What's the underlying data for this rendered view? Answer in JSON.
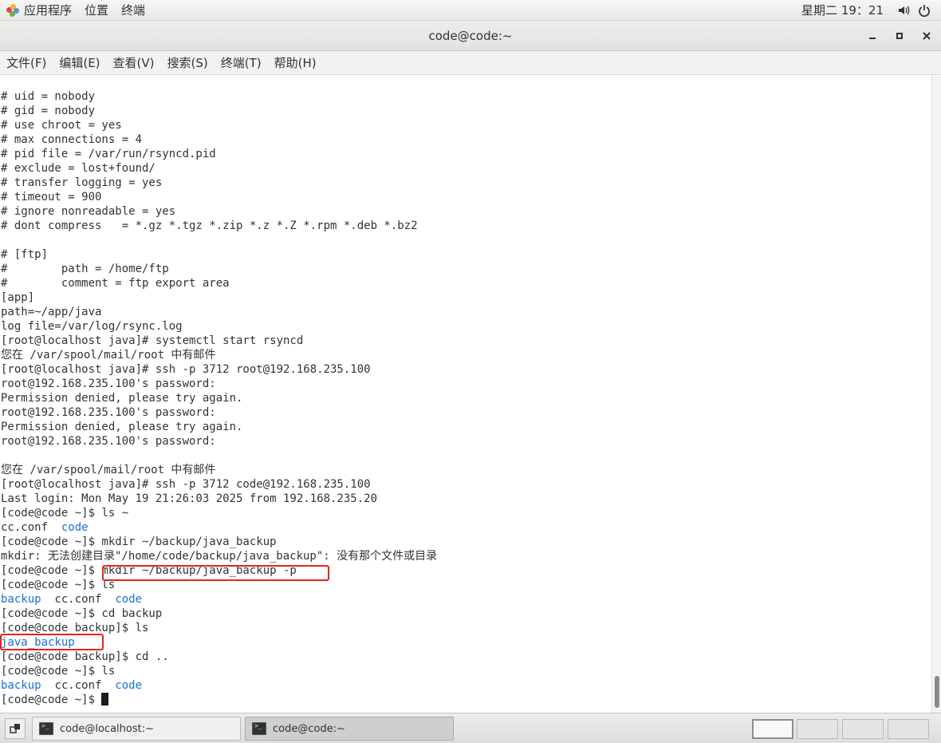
{
  "top_panel": {
    "apps_label": "应用程序",
    "places_label": "位置",
    "terminal_label": "终端",
    "clock": "星期二 19：21",
    "volume_icon": "speaker-icon",
    "power_icon": "power-icon"
  },
  "window": {
    "title": "code@code:~",
    "minimize_icon": "minimize-icon",
    "maximize_icon": "maximize-icon",
    "close_icon": "close-icon"
  },
  "menu": [
    "文件(F)",
    "编辑(E)",
    "查看(V)",
    "搜索(S)",
    "终端(T)",
    "帮助(H)"
  ],
  "terminal_lines": [
    "# uid = nobody",
    "# gid = nobody",
    "# use chroot = yes",
    "# max connections = 4",
    "# pid file = /var/run/rsyncd.pid",
    "# exclude = lost+found/",
    "# transfer logging = yes",
    "# timeout = 900",
    "# ignore nonreadable = yes",
    "# dont compress   = *.gz *.tgz *.zip *.z *.Z *.rpm *.deb *.bz2",
    "",
    "# [ftp]",
    "#        path = /home/ftp",
    "#        comment = ftp export area",
    "[app]",
    "path=~/app/java",
    "log file=/var/log/rsync.log",
    "[root@localhost java]# systemctl start rsyncd",
    "您在 /var/spool/mail/root 中有邮件",
    "[root@localhost java]# ssh -p 3712 root@192.168.235.100",
    "root@192.168.235.100's password:",
    "Permission denied, please try again.",
    "root@192.168.235.100's password:",
    "Permission denied, please try again.",
    "root@192.168.235.100's password:",
    "",
    "您在 /var/spool/mail/root 中有邮件",
    "[root@localhost java]# ssh -p 3712 code@192.168.235.100",
    "Last login: Mon May 19 21:26:03 2025 from 192.168.235.20",
    "[code@code ~]$ ls ~",
    "",
    "[code@code ~]$ mkdir ~/backup/java_backup",
    "mkdir: 无法创建目录\"/home/code/backup/java_backup\": 没有那个文件或目录",
    "[code@code ~]$ mkdir ~/backup/java_backup -p",
    "[code@code ~]$ ls",
    "",
    "[code@code ~]$ cd backup",
    "[code@code backup]$ ls",
    "",
    "[code@code backup]$ cd ..",
    "[code@code ~]$ ls",
    "",
    "[code@code ~]$ "
  ],
  "listings": {
    "ls_home_1": {
      "file": "cc.conf",
      "dir": "code"
    },
    "ls_home_2": {
      "dir1": "backup",
      "file": "cc.conf",
      "dir2": "code"
    },
    "ls_backup": {
      "dir": "java_backup"
    },
    "ls_home_3": {
      "dir1": "backup",
      "file": "cc.conf",
      "dir2": "code"
    }
  },
  "colors": {
    "directory": "#1a6fd9",
    "highlight_box": "#e8221b",
    "text": "#2e3436"
  },
  "taskbar": {
    "show_desktop_icon": "show-desktop-icon",
    "tasks": [
      {
        "label": "code@localhost:~",
        "active": false
      },
      {
        "label": "code@code:~",
        "active": true
      }
    ],
    "workspaces": 4,
    "active_workspace": 1
  }
}
